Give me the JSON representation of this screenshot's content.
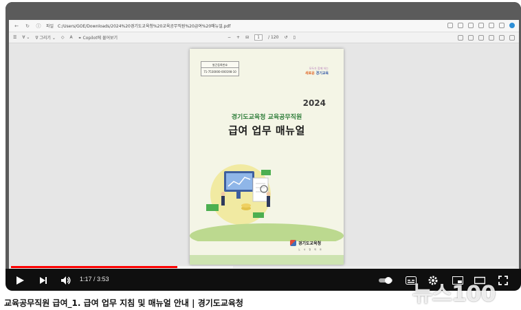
{
  "browser": {
    "address_prefix": "파일",
    "url": "C:/Users/GOE/Downloads/2024%20경기도교육청%20교육공무직원%20급여%20매뉴얼.pdf"
  },
  "pdf_toolbar": {
    "draw_label": "그리기",
    "copilot_label": "Copilot에 물어보기",
    "page_current": "1",
    "page_total": "/ 120"
  },
  "cover": {
    "reg_label": "발간등록번호",
    "reg_number": "71-7530000-000198-10",
    "slogan_top": "모두가 함께 하는",
    "slogan_highlight": "새로운",
    "slogan_main": "경기교육",
    "year": "2024",
    "subtitle": "경기도교육청 교육공무직원",
    "title": "급여 업무 매뉴얼",
    "publisher": "경기도교육청",
    "publisher_sub": "노 사 협 력 과"
  },
  "player": {
    "time_display": "1:17 / 3:53",
    "progress_played": 0.33,
    "progress_loaded": 0.44,
    "icons": {
      "play": "play-icon",
      "next": "next-icon",
      "volume": "volume-icon",
      "autoplay": "autoplay-toggle-icon",
      "subtitles": "subtitles-icon",
      "settings": "gear-icon",
      "miniplayer": "miniplayer-icon",
      "theater": "theater-icon",
      "fullscreen": "fullscreen-icon"
    }
  },
  "video": {
    "title": "교육공무직원 급여_1. 급여 업무 지침 및 매뉴얼 안내 |  경기도교육청"
  },
  "watermark": "뉴스100"
}
